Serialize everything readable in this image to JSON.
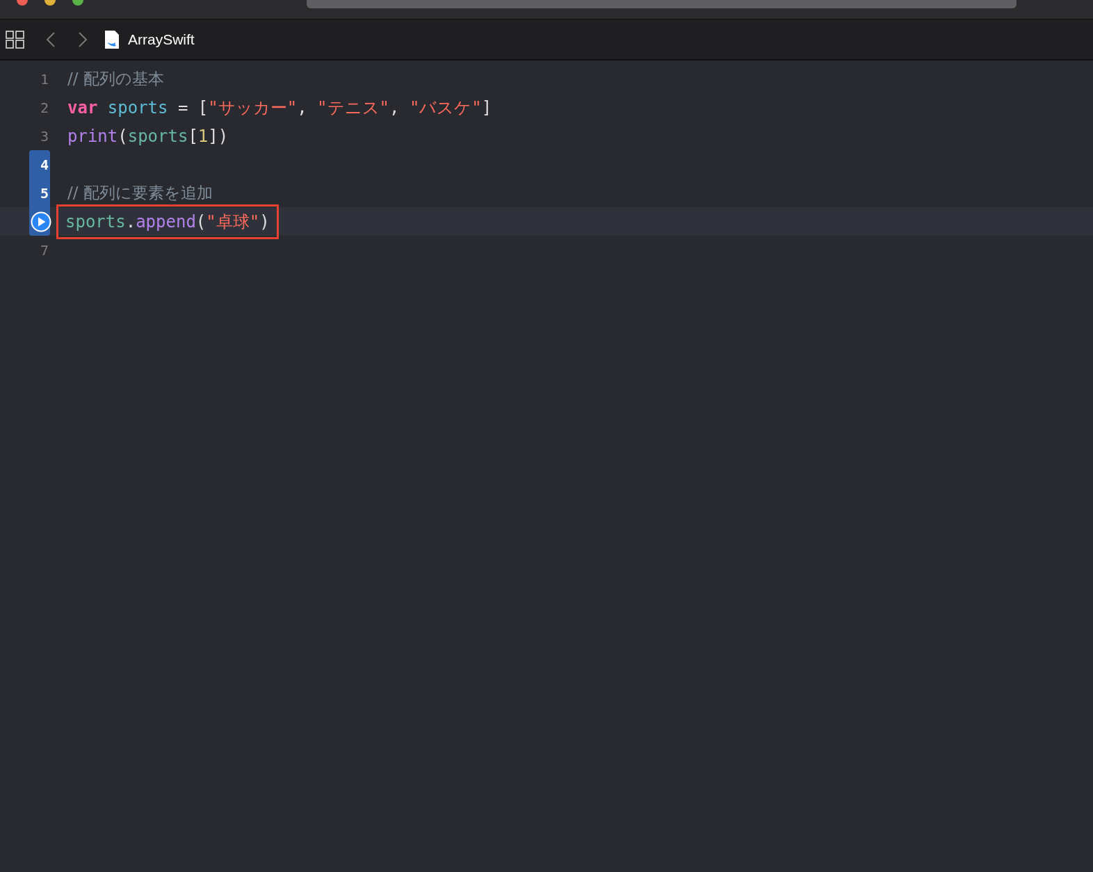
{
  "editor_tab": {
    "file_name": "ArraySwift"
  },
  "lines": [
    {
      "number": "1",
      "in_range": false,
      "current": false,
      "outlined": false,
      "tokens": [
        {
          "kind": "comment",
          "text": "// 配列の基本"
        }
      ]
    },
    {
      "number": "2",
      "in_range": false,
      "current": false,
      "outlined": false,
      "tokens": [
        {
          "kind": "keyword",
          "text": "var "
        },
        {
          "kind": "declaration",
          "text": "sports"
        },
        {
          "kind": "plain",
          "text": " = ["
        },
        {
          "kind": "string",
          "text": "\"サッカー\""
        },
        {
          "kind": "plain",
          "text": ", "
        },
        {
          "kind": "string",
          "text": "\"テニス\""
        },
        {
          "kind": "plain",
          "text": ", "
        },
        {
          "kind": "string",
          "text": "\"バスケ\""
        },
        {
          "kind": "plain",
          "text": "]"
        }
      ]
    },
    {
      "number": "3",
      "in_range": false,
      "current": false,
      "outlined": false,
      "tokens": [
        {
          "kind": "function",
          "text": "print"
        },
        {
          "kind": "plain",
          "text": "("
        },
        {
          "kind": "identifier",
          "text": "sports"
        },
        {
          "kind": "plain",
          "text": "["
        },
        {
          "kind": "number",
          "text": "1"
        },
        {
          "kind": "plain",
          "text": "])"
        }
      ]
    },
    {
      "number": "4",
      "in_range": true,
      "current": false,
      "outlined": false
    },
    {
      "number": "5",
      "in_range": true,
      "current": false,
      "outlined": false,
      "tokens": [
        {
          "kind": "comment",
          "text": "// 配列に要素を追加"
        }
      ]
    },
    {
      "in_range": true,
      "current": true,
      "outlined": true,
      "tokens": [
        {
          "kind": "identifier",
          "text": "sports"
        },
        {
          "kind": "plain",
          "text": "."
        },
        {
          "kind": "function",
          "text": "append"
        },
        {
          "kind": "plain",
          "text": "("
        },
        {
          "kind": "string",
          "text": "\"卓球\""
        },
        {
          "kind": "plain",
          "text": ")"
        }
      ]
    },
    {
      "number": "7",
      "in_range": false,
      "current": false,
      "outlined": false
    }
  ]
}
